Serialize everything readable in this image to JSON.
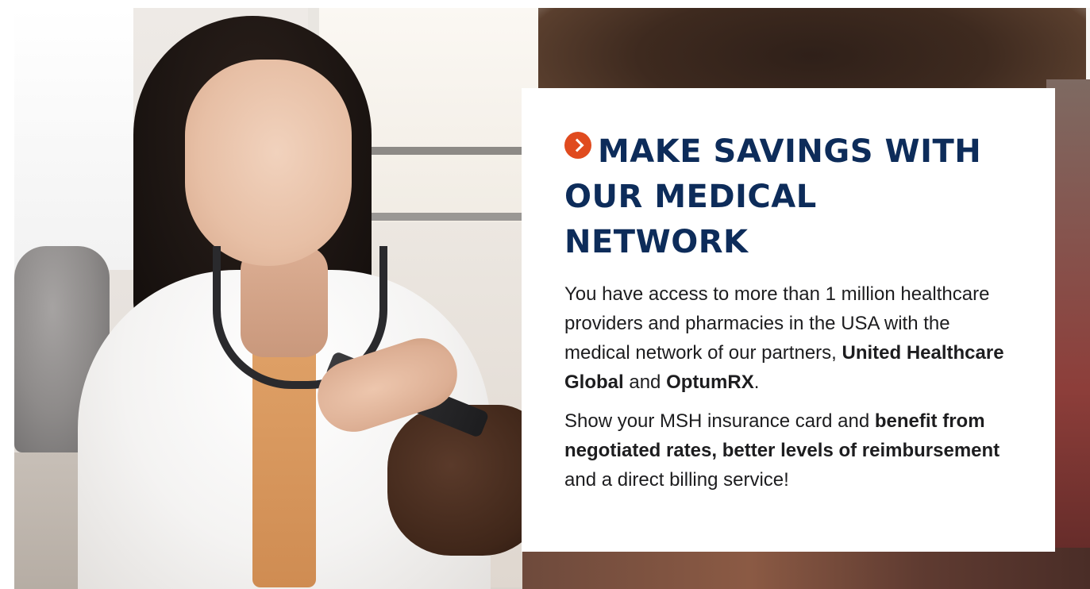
{
  "card": {
    "headline": "MAKE SAVINGS WITH OUR MEDICAL NETWORK",
    "paragraph1": {
      "text_before": "You have access to more than 1 million healthcare providers and pharmacies in the USA with the medical network of our partners, ",
      "partner1": "United Healthcare Global",
      "connector": " and ",
      "partner2": "OptumRX",
      "text_after": "."
    },
    "paragraph2": {
      "text_before": "Show your MSH insurance card and ",
      "benefit": "benefit from negotiated rates, better levels of reimbursement",
      "text_after": " and a direct billing service!"
    }
  },
  "icons": {
    "headline_icon": "chevron-right-circle-icon"
  },
  "colors": {
    "headline": "#0d2c5a",
    "accent": "#e04b1f",
    "body_text": "#1d1d1f",
    "card_background": "#ffffff"
  }
}
